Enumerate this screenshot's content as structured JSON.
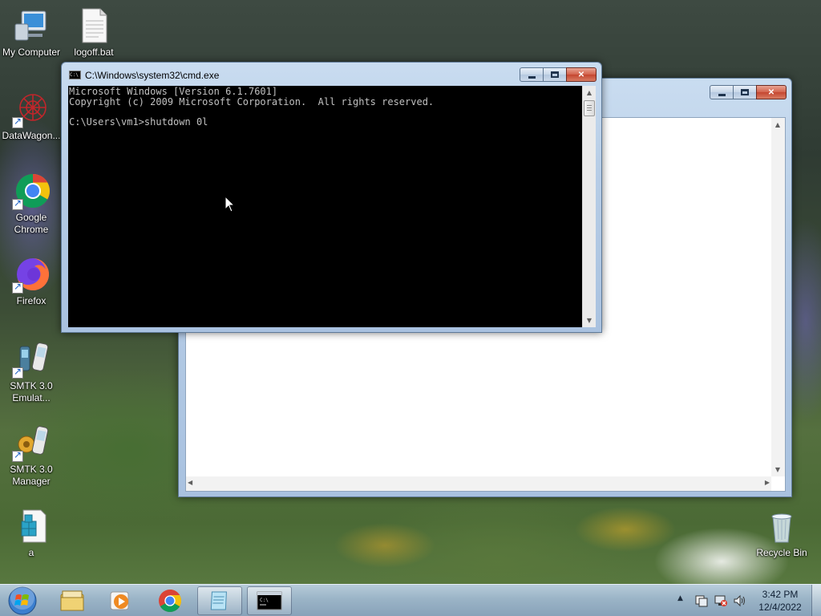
{
  "desktop": {
    "icons": [
      {
        "label": "My Computer",
        "icon": "computer-icon"
      },
      {
        "label": "logoff.bat",
        "icon": "batch-file-icon"
      },
      {
        "label": "DataWagon...",
        "icon": "datawagon-icon"
      },
      {
        "label": "Google Chrome",
        "icon": "chrome-icon"
      },
      {
        "label": "Firefox",
        "icon": "firefox-icon"
      },
      {
        "label": "SMTK 3.0 Emulat...",
        "icon": "smtk-emulator-icon"
      },
      {
        "label": "SMTK 3.0 Manager",
        "icon": "smtk-manager-icon"
      },
      {
        "label": "a",
        "icon": "registry-icon"
      },
      {
        "label": "Recycle Bin",
        "icon": "recycle-bin-icon"
      }
    ]
  },
  "cmd_window": {
    "title": "C:\\Windows\\system32\\cmd.exe",
    "lines": [
      "Microsoft Windows [Version 6.1.7601]",
      "Copyright (c) 2009 Microsoft Corporation.  All rights reserved.",
      "",
      "C:\\Users\\vm1>shutdown 0l"
    ]
  },
  "taskbar": {
    "pinned": [
      {
        "name": "start-button",
        "icon": "windows-logo-icon"
      },
      {
        "name": "explorer",
        "icon": "folder-icon"
      },
      {
        "name": "media-player",
        "icon": "media-player-icon"
      },
      {
        "name": "chrome",
        "icon": "chrome-icon"
      },
      {
        "name": "notepad",
        "icon": "notepad-icon"
      },
      {
        "name": "cmd",
        "icon": "cmd-icon"
      }
    ],
    "tray_icons": [
      "show-hidden-icons-icon",
      "action-center-icon",
      "network-icon",
      "volume-icon"
    ],
    "clock": {
      "time": "3:42 PM",
      "date": "12/4/2022"
    }
  },
  "colors": {
    "console_bg": "#000000",
    "console_fg": "#c0c0c0",
    "close_button": "#c44630",
    "window_frame": "#b7cde6"
  }
}
